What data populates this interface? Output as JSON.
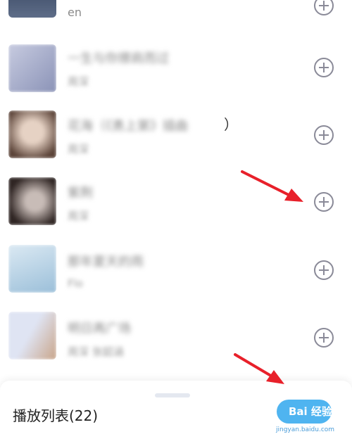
{
  "playlist": {
    "top_partial": {
      "subtitle": "en"
    },
    "items": [
      {
        "title": "一生与你擦肩而过",
        "subtitle": "周深",
        "colors": [
          "#c7cbe0",
          "#8b93b7"
        ]
      },
      {
        "title": "花海（《勇上第》插曲",
        "title_tail": "）",
        "subtitle": "周深",
        "colors": [
          "#e6d2c4",
          "#5b4338"
        ]
      },
      {
        "title": "紫荆",
        "subtitle": "周深",
        "colors": [
          "#c8bcb7",
          "#2f2523"
        ]
      },
      {
        "title": "那年夏天的雨",
        "subtitle": "Flo",
        "colors": [
          "#dbe9f3",
          "#9bbfd9"
        ]
      },
      {
        "title": "明日再广场",
        "subtitle": "周深 张韶涵",
        "colors": [
          "#dfe4f3",
          "#c9a58a"
        ]
      }
    ]
  },
  "sheet": {
    "title": "播放列表(22)"
  },
  "watermark": {
    "text": "Bai 经验",
    "sub": "jingyan.baidu.com"
  },
  "colors": {
    "arrow": "#e8202a",
    "add_icon": "#8a8a98"
  }
}
